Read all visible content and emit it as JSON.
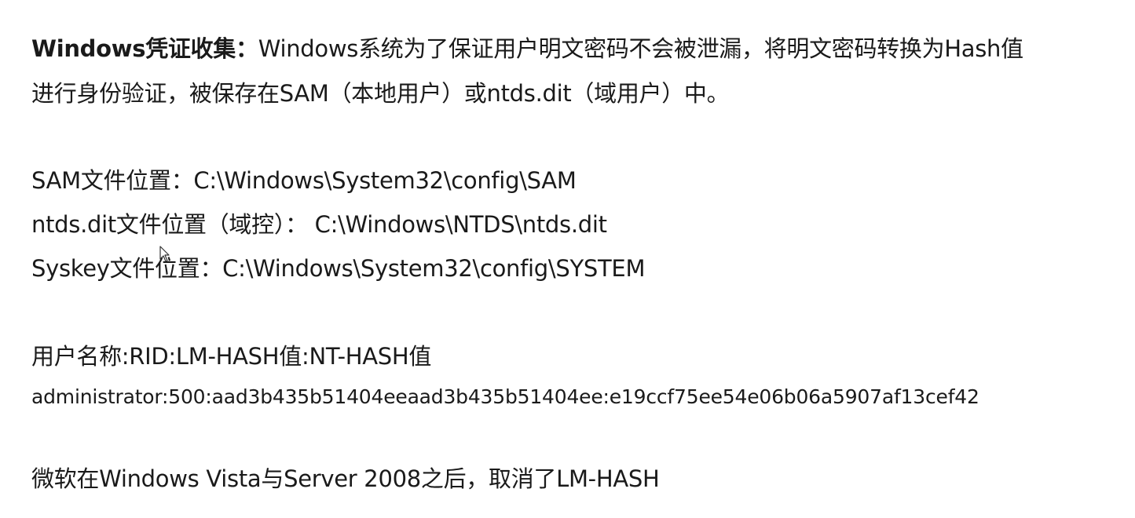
{
  "intro": {
    "heading": "Windows凭证收集：",
    "line1_text": "Windows系统为了保证用户明文密码不会被泄漏，将明文密码转换为Hash值",
    "line2_text": "进行身份验证，被保存在SAM（本地用户）或ntds.dit（域用户）中。"
  },
  "locations": {
    "sam": "SAM文件位置：C:\\Windows\\System32\\config\\SAM",
    "ntds": "ntds.dit文件位置（域控）： C:\\Windows\\NTDS\\ntds.dit",
    "syskey": "Syskey文件位置：C:\\Windows\\System32\\config\\SYSTEM"
  },
  "hash_format": {
    "label": "用户名称:RID:LM-HASH值:NT-HASH值",
    "example": "administrator:500:aad3b435b51404eeaad3b435b51404ee:e19ccf75ee54e06b06a5907af13cef42"
  },
  "note": "微软在Windows Vista与Server 2008之后，取消了LM-HASH",
  "icons": {
    "cursor": "mouse-pointer-icon"
  }
}
